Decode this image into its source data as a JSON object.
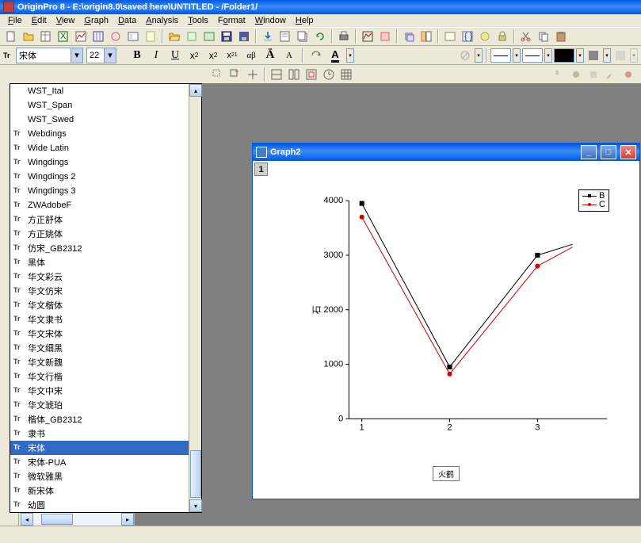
{
  "title": "OriginPro 8 - E:\\origin8.0\\saved here\\UNTITLED - /Folder1/",
  "menus": [
    "File",
    "Edit",
    "View",
    "Graph",
    "Data",
    "Analysis",
    "Tools",
    "Format",
    "Window",
    "Help"
  ],
  "menu_accel": [
    "F",
    "E",
    "V",
    "G",
    "D",
    "A",
    "T",
    "o",
    "W",
    "H"
  ],
  "font": {
    "name": "宋体",
    "size": "22"
  },
  "format_buttons": {
    "bold": "B",
    "italic": "I",
    "underline": "U",
    "sup": "x²",
    "sub": "x₂",
    "supsub": "x₂¹",
    "greek": "αβ",
    "bigA": "A",
    "smallA": "A"
  },
  "font_list": [
    "WST_Ital",
    "WST_Span",
    "WST_Swed",
    "Webdings",
    "Wide Latin",
    "Wingdings",
    "Wingdings 2",
    "Wingdings 3",
    "ZWAdobeF",
    "方正舒体",
    "方正姚体",
    "仿宋_GB2312",
    "黑体",
    "华文彩云",
    "华文仿宋",
    "华文楷体",
    "华文隶书",
    "华文宋体",
    "华文细黑",
    "华文新魏",
    "华文行楷",
    "华文中宋",
    "华文琥珀",
    "楷体_GB2312",
    "隶书",
    "宋体",
    "宋体-PUA",
    "微软雅黑",
    "新宋体",
    "幼圆"
  ],
  "font_no_tt": [
    0,
    1,
    2
  ],
  "font_selected": 25,
  "graph": {
    "title": "Graph2",
    "layer": "1"
  },
  "legend": {
    "b": "B",
    "c": "C"
  },
  "xlabel": "火鹤",
  "chart_data": {
    "type": "line",
    "x": [
      1,
      2,
      3
    ],
    "xlabel": "火鹤",
    "ylabel": "石",
    "ylim": [
      0,
      4000
    ],
    "yticks": [
      0,
      1000,
      2000,
      3000,
      4000
    ],
    "series": [
      {
        "name": "B",
        "color": "#000000",
        "marker": "square",
        "values": [
          3950,
          950,
          3000
        ]
      },
      {
        "name": "C",
        "color": "#d00000",
        "marker": "circle",
        "values": [
          3700,
          820,
          2800
        ]
      }
    ],
    "extra_point_right": {
      "b": 3200,
      "c": 3150,
      "x": 3.4
    }
  }
}
